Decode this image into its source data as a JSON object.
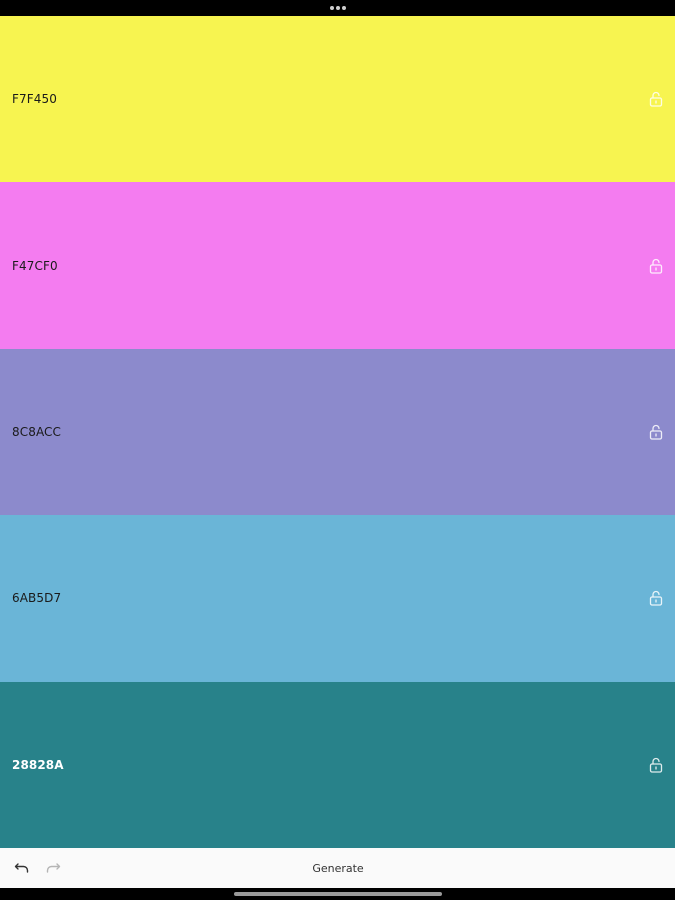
{
  "palette": {
    "swatches": [
      {
        "hex": "F7F450",
        "color": "#F7F450",
        "text_color": "#1a1a1a",
        "text_weight": "normal",
        "lock_color": "#ffffff"
      },
      {
        "hex": "F47CF0",
        "color": "#F47CF0",
        "text_color": "#1a1a1a",
        "text_weight": "normal",
        "lock_color": "#ffffff"
      },
      {
        "hex": "8C8ACC",
        "color": "#8C8ACC",
        "text_color": "#1a1a1a",
        "text_weight": "normal",
        "lock_color": "#ffffff"
      },
      {
        "hex": "6AB5D7",
        "color": "#6AB5D7",
        "text_color": "#1a1a1a",
        "text_weight": "normal",
        "lock_color": "#ffffff"
      },
      {
        "hex": "28828A",
        "color": "#28828A",
        "text_color": "#ffffff",
        "text_weight": "bold",
        "lock_color": "#ffffff"
      }
    ],
    "lock_icon": "unlocked-padlock-icon"
  },
  "toolbar": {
    "undo_icon": "undo-arrow-icon",
    "redo_icon": "redo-arrow-icon",
    "generate_label": "Generate",
    "background": "#fafafa"
  },
  "system": {
    "multitask_icon": "multitasking-dots-icon",
    "home_indicator": "home-indicator-bar"
  }
}
